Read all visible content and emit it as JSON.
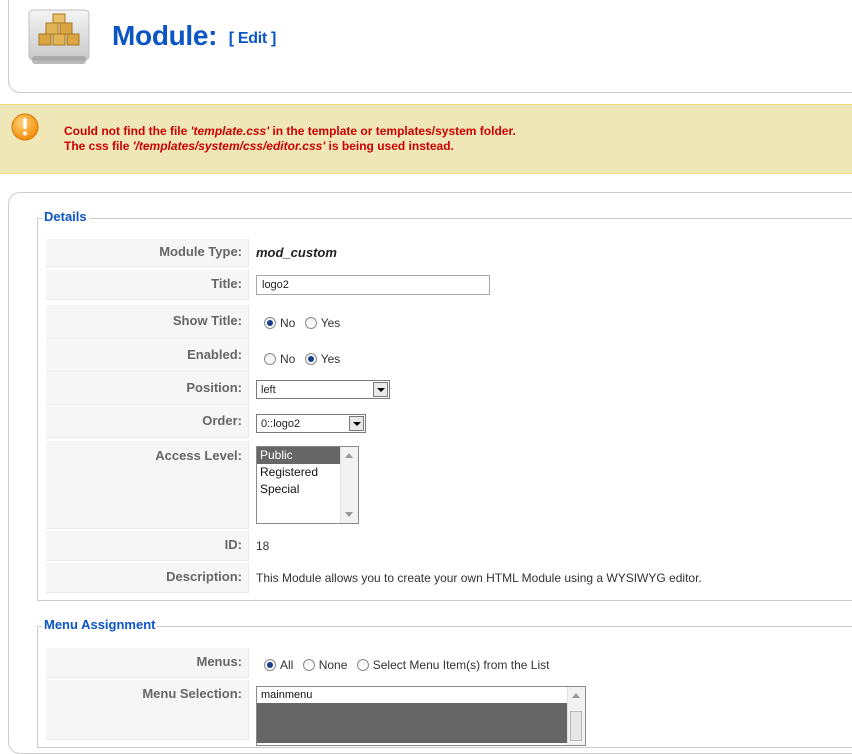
{
  "header": {
    "title": "Module:",
    "edit_label": "[ Edit ]",
    "icon": "module-icon"
  },
  "notice": {
    "icon": "warning-icon",
    "line1_pre": "Could not find the file ",
    "line1_file": "'template.css'",
    "line1_post": " in the template or templates/system folder.",
    "line2_pre": "The css file ",
    "line2_file": "'/templates/system/css/editor.css'",
    "line2_post": " is being used instead."
  },
  "details": {
    "legend": "Details",
    "module_type_label": "Module Type:",
    "module_type_value": "mod_custom",
    "title_label": "Title:",
    "title_value": "logo2",
    "show_title_label": "Show Title:",
    "show_title_options": [
      "No",
      "Yes"
    ],
    "show_title_selected": "No",
    "enabled_label": "Enabled:",
    "enabled_options": [
      "No",
      "Yes"
    ],
    "enabled_selected": "Yes",
    "position_label": "Position:",
    "position_value": "left",
    "order_label": "Order:",
    "order_value": "0::logo2",
    "access_label": "Access Level:",
    "access_options": [
      "Public",
      "Registered",
      "Special"
    ],
    "access_selected": "Public",
    "id_label": "ID:",
    "id_value": "18",
    "description_label": "Description:",
    "description_value": "This Module allows you to create your own HTML Module using a WYSIWYG editor."
  },
  "menu_assignment": {
    "legend": "Menu Assignment",
    "menus_label": "Menus:",
    "menus_options": [
      "All",
      "None",
      "Select Menu Item(s) from the List"
    ],
    "menus_selected": "All",
    "selection_label": "Menu Selection:",
    "selection_items": [
      "mainmenu",
      ""
    ]
  }
}
